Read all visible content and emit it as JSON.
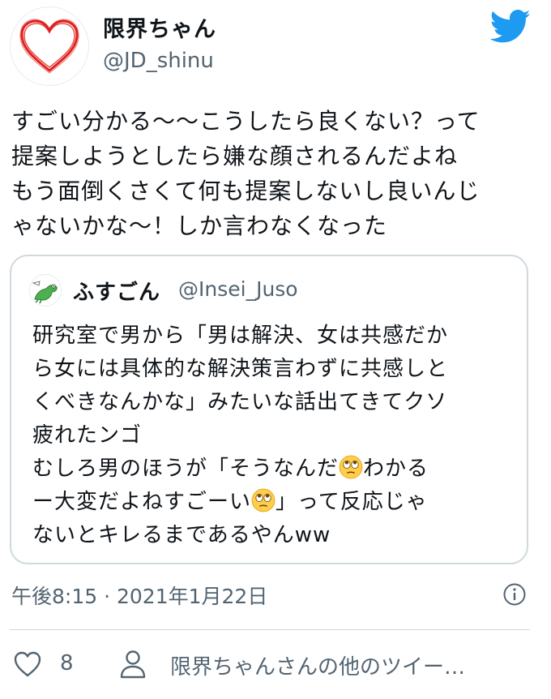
{
  "author": {
    "display_name": "限界ちゃん",
    "handle": "@JD_shinu",
    "avatar_icon": "heart-icon"
  },
  "brand": {
    "logo_icon": "twitter-bird-icon",
    "color": "#1d9bf0"
  },
  "tweet": {
    "lines": [
      "すごい分かる〜〜こうしたら良くない？って",
      "提案しようとしたら嫌な顔されるんだよね",
      "もう面倒くさくて何も提案しないし良いんじ",
      "ゃないかな〜！しか言わなくなった"
    ]
  },
  "quoted_tweet": {
    "display_name": "ふすごん",
    "handle": "@Insei_Juso",
    "avatar_icon": "frog-icon",
    "lines": [
      {
        "text": "研究室で男から「男は解決、女は共感だか"
      },
      {
        "text": "ら女には具体的な解決策言わずに共感しと"
      },
      {
        "text": "くべきなんかな」みたいな話出てきてクソ"
      },
      {
        "text": "疲れたンゴ"
      },
      {
        "before": "むしろ男のほうが「そうなんだ",
        "emoji": "face-with-rolling-eyes",
        "after": "わかる"
      },
      {
        "before": "ー大変だよねすごーい",
        "emoji": "face-with-rolling-eyes",
        "after": "」って反応じゃ"
      },
      {
        "text": "ないとキレるまであるやんww"
      }
    ]
  },
  "meta": {
    "timestamp": "午後8:15 · 2021年1月22日",
    "info_icon": "info-icon"
  },
  "actions": {
    "like_count": "8",
    "more_tweets_label": "限界ちゃんさんの他のツイー…"
  }
}
